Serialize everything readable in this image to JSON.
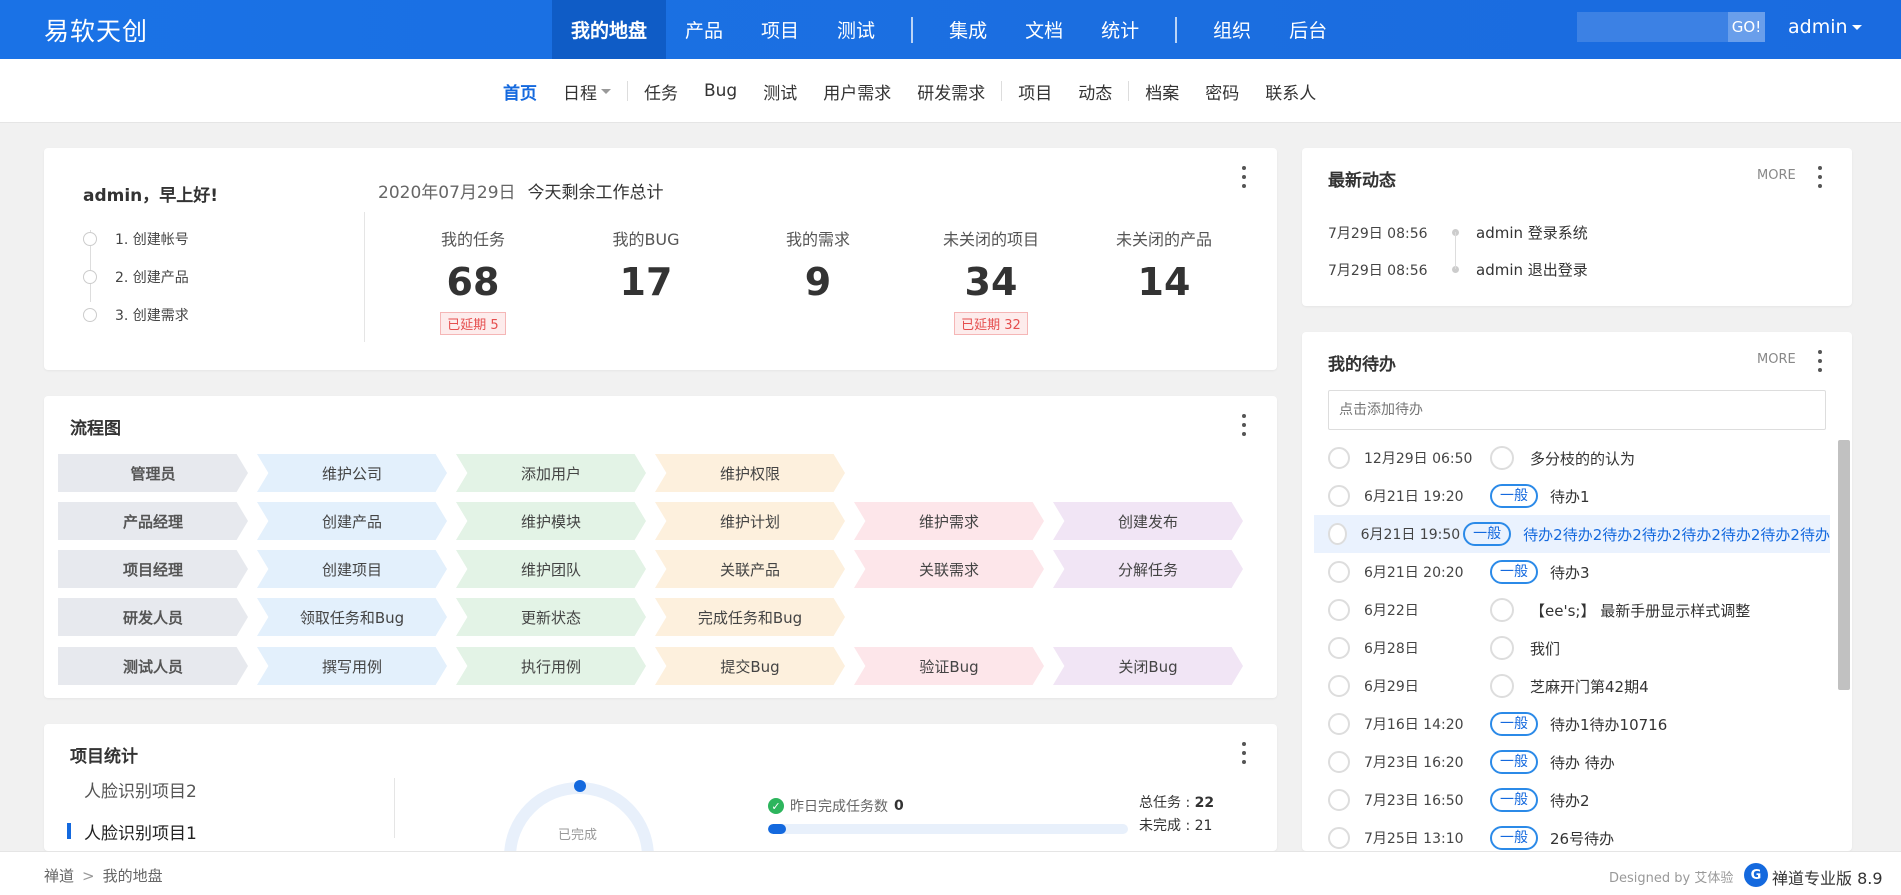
{
  "brand": "易软天创",
  "mainnav": [
    "我的地盘",
    "产品",
    "项目",
    "测试",
    "集成",
    "文档",
    "统计",
    "组织",
    "后台"
  ],
  "search": {
    "button": "GO!"
  },
  "user": "admin",
  "subnav": [
    "首页",
    "日程",
    "任务",
    "Bug",
    "测试",
    "用户需求",
    "研发需求",
    "项目",
    "动态",
    "档案",
    "密码",
    "联系人"
  ],
  "welcome": {
    "greeting": "admin，早上好!",
    "steps": [
      "1. 创建帐号",
      "2. 创建产品",
      "3. 创建需求"
    ],
    "date": "2020年07月29日",
    "summary": "今天剩余工作总计",
    "stats": [
      {
        "label": "我的任务",
        "value": "68",
        "badge": "已延期 5"
      },
      {
        "label": "我的BUG",
        "value": "17",
        "badge": ""
      },
      {
        "label": "我的需求",
        "value": "9",
        "badge": ""
      },
      {
        "label": "未关闭的项目",
        "value": "34",
        "badge": "已延期 32"
      },
      {
        "label": "未关闭的产品",
        "value": "14",
        "badge": ""
      }
    ]
  },
  "flow": {
    "title": "流程图",
    "rows": [
      {
        "role": "管理员",
        "steps": [
          "维护公司",
          "添加用户",
          "维护权限"
        ]
      },
      {
        "role": "产品经理",
        "steps": [
          "创建产品",
          "维护模块",
          "维护计划",
          "维护需求",
          "创建发布"
        ]
      },
      {
        "role": "项目经理",
        "steps": [
          "创建项目",
          "维护团队",
          "关联产品",
          "关联需求",
          "分解任务"
        ]
      },
      {
        "role": "研发人员",
        "steps": [
          "领取任务和Bug",
          "更新状态",
          "完成任务和Bug"
        ]
      },
      {
        "role": "测试人员",
        "steps": [
          "撰写用例",
          "执行用例",
          "提交Bug",
          "验证Bug",
          "关闭Bug"
        ]
      }
    ]
  },
  "project_stats": {
    "title": "项目统计",
    "projects": [
      "人脸识别项目2",
      "人脸识别项目1"
    ],
    "ring_label": "已完成",
    "yesterday_label": "昨日完成任务数",
    "yesterday_value": "0",
    "progress_percent": 5,
    "total_label": "总任务 :",
    "total_value": "22",
    "undone_label": "未完成 :",
    "undone_value": "21"
  },
  "dynamics": {
    "title": "最新动态",
    "more": "MORE",
    "items": [
      {
        "time": "7月29日 08:56",
        "text": "admin 登录系统"
      },
      {
        "time": "7月29日 08:56",
        "text": "admin 退出登录"
      }
    ]
  },
  "todo": {
    "title": "我的待办",
    "more": "MORE",
    "placeholder": "点击添加待办",
    "items": [
      {
        "date": "12月29日 06:50",
        "priority": "",
        "name": "多分枝的的认为"
      },
      {
        "date": "6月21日 19:20",
        "priority": "一般",
        "name": "待办1"
      },
      {
        "date": "6月21日 19:50",
        "priority": "一般",
        "name": "待办2待办2待办2待办2待办2待办2待办2待办"
      },
      {
        "date": "6月21日 20:20",
        "priority": "一般",
        "name": "待办3"
      },
      {
        "date": "6月22日",
        "priority": "",
        "name": "【ee's;】 最新手册显示样式调整"
      },
      {
        "date": "6月28日",
        "priority": "",
        "name": "我们"
      },
      {
        "date": "6月29日",
        "priority": "",
        "name": "芝麻开门第42期4"
      },
      {
        "date": "7月16日 14:20",
        "priority": "一般",
        "name": "待办1待办10716"
      },
      {
        "date": "7月23日 16:20",
        "priority": "一般",
        "name": "待办 待办"
      },
      {
        "date": "7月23日 16:50",
        "priority": "一般",
        "name": "待办2"
      },
      {
        "date": "7月25日 13:10",
        "priority": "一般",
        "name": "26号待办"
      }
    ]
  },
  "footer": {
    "crumbs": [
      "禅道",
      "我的地盘"
    ],
    "designed": "Designed by 艾体验",
    "logo": "G",
    "version": "禅道专业版 8.9"
  }
}
